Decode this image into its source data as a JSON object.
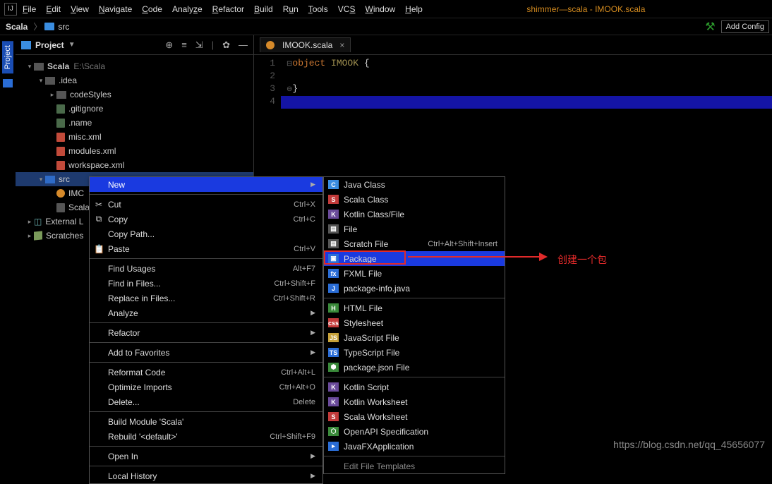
{
  "menubar": {
    "items": [
      "File",
      "Edit",
      "View",
      "Navigate",
      "Code",
      "Analyze",
      "Refactor",
      "Build",
      "Run",
      "Tools",
      "VCS",
      "Window",
      "Help"
    ],
    "title": "shimmer—scala - IMOOK.scala"
  },
  "breadcrumb": {
    "root": "Scala",
    "child": "src",
    "add_config": "Add Config"
  },
  "project": {
    "title": "Project",
    "root_name": "Scala",
    "root_path": "E:\\Scala",
    "idea": ".idea",
    "codeStyles": "codeStyles",
    "gitignore": ".gitignore",
    "name": ".name",
    "misc": "misc.xml",
    "modules": "modules.xml",
    "workspace": "workspace.xml",
    "src": "src",
    "imc": "IMC",
    "scalain": "Scala.in",
    "external": "External L",
    "scratches": "Scratches"
  },
  "tab": {
    "label": "IMOOK.scala"
  },
  "code": {
    "l1a": "object",
    "l1b": "IMOOK",
    "l1c": "{",
    "l3": "}"
  },
  "ctx": {
    "new": "New",
    "cut": "Cut",
    "cut_s": "Ctrl+X",
    "copy": "Copy",
    "copy_s": "Ctrl+C",
    "copypath": "Copy Path...",
    "paste": "Paste",
    "paste_s": "Ctrl+V",
    "findu": "Find Usages",
    "findu_s": "Alt+F7",
    "findf": "Find in Files...",
    "findf_s": "Ctrl+Shift+F",
    "replf": "Replace in Files...",
    "replf_s": "Ctrl+Shift+R",
    "analyze": "Analyze",
    "refactor": "Refactor",
    "fav": "Add to Favorites",
    "reform": "Reformat Code",
    "reform_s": "Ctrl+Alt+L",
    "optim": "Optimize Imports",
    "optim_s": "Ctrl+Alt+O",
    "delete": "Delete...",
    "delete_s": "Delete",
    "buildm": "Build Module 'Scala'",
    "rebuild": "Rebuild '<default>'",
    "rebuild_s": "Ctrl+Shift+F9",
    "openin": "Open In",
    "localh": "Local History",
    "sidebar": "Project"
  },
  "sub": {
    "java": "Java Class",
    "scala": "Scala Class",
    "kotlin": "Kotlin Class/File",
    "file": "File",
    "scratch": "Scratch File",
    "scratch_s": "Ctrl+Alt+Shift+Insert",
    "package": "Package",
    "fxml": "FXML File",
    "pkginfo": "package-info.java",
    "html": "HTML File",
    "css": "Stylesheet",
    "js": "JavaScript File",
    "ts": "TypeScript File",
    "pkgjson": "package.json File",
    "kts": "Kotlin Script",
    "ktws": "Kotlin Worksheet",
    "scws": "Scala Worksheet",
    "openapi": "OpenAPI Specification",
    "jfx": "JavaFXApplication",
    "eft": "Edit File Templates"
  },
  "anno": "创建一个包",
  "watermark": "https://blog.csdn.net/qq_45656077"
}
